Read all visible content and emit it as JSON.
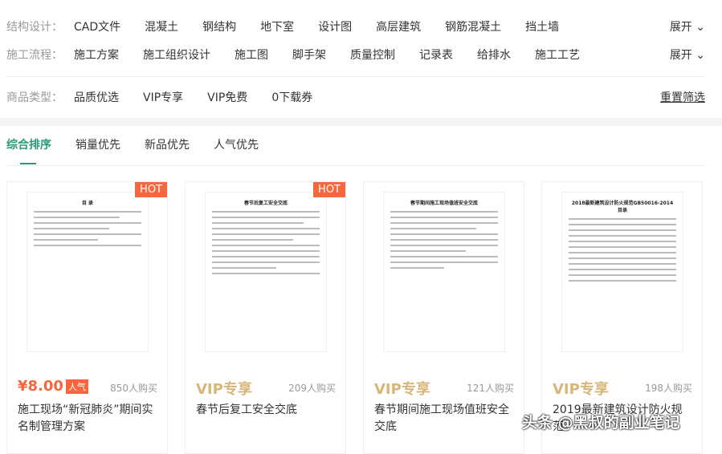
{
  "filters": [
    {
      "label": "结构设计：",
      "items": [
        "CAD文件",
        "混凝土",
        "钢结构",
        "地下室",
        "设计图",
        "高层建筑",
        "钢筋混凝土",
        "挡土墙"
      ],
      "action": "展开 ⌄"
    },
    {
      "label": "施工流程：",
      "items": [
        "施工方案",
        "施工组织设计",
        "施工图",
        "脚手架",
        "质量控制",
        "记录表",
        "给排水",
        "施工工艺"
      ],
      "action": "展开 ⌄"
    },
    {
      "label": "商品类型：",
      "items": [
        "品质优选",
        "VIP专享",
        "VIP免费",
        "0下载券"
      ],
      "action": "重置筛选"
    }
  ],
  "tabs": [
    "综合排序",
    "销量优先",
    "新品优先",
    "人气优先"
  ],
  "products": [
    {
      "doc_title": "目  录",
      "badge": "HOT",
      "price": "¥8.00",
      "tag": "人气",
      "sold": "850人购买",
      "title": "施工现场“新冠肺炎”期间实名制管理方案"
    },
    {
      "doc_title": "春节后复工安全交底",
      "badge": "HOT",
      "price": "VIP专享",
      "sold": "209人购买",
      "title": "春节后复工安全交底"
    },
    {
      "doc_title": "春节期间施工现场值班安全交底",
      "price": "VIP专享",
      "sold": "121人购买",
      "title": "春节期间施工现场值班安全交底"
    },
    {
      "doc_title": "2018最新建筑设计防火规范GB50016-2014 目录",
      "price": "VIP专享",
      "sold": "198人购买",
      "title": "2019最新建筑设计防火规范"
    }
  ],
  "watermark": "头条 @黑叔的副业笔记",
  "colors": {
    "accent": "#2a9a72",
    "hot": "#f5683d",
    "vip": "#d8b67a"
  }
}
